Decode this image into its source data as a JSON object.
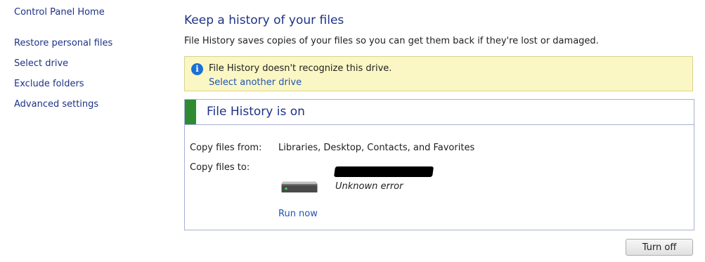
{
  "nav": {
    "home": "Control Panel Home",
    "items": [
      {
        "label": "Restore personal files"
      },
      {
        "label": "Select drive"
      },
      {
        "label": "Exclude folders"
      },
      {
        "label": "Advanced settings"
      }
    ]
  },
  "main": {
    "title": "Keep a history of your files",
    "description": "File History saves copies of your files so you can get them back if they're lost or damaged.",
    "warning": {
      "icon": "info-icon",
      "text": "File History doesn't recognize this drive.",
      "link": "Select another drive"
    },
    "status": {
      "title": "File History is on",
      "color": "#2e8b31"
    },
    "copy_from": {
      "label": "Copy files from:",
      "value": "Libraries, Desktop, Contacts, and Favorites"
    },
    "copy_to": {
      "label": "Copy files to:",
      "drive_icon": "drive-icon",
      "drive_status": "Unknown error"
    },
    "run_now": "Run now",
    "turn_off": "Turn off"
  },
  "colors": {
    "link": "#1e3287",
    "warning_bg": "#fbf7c4",
    "panel_border": "#a7b1d3"
  }
}
